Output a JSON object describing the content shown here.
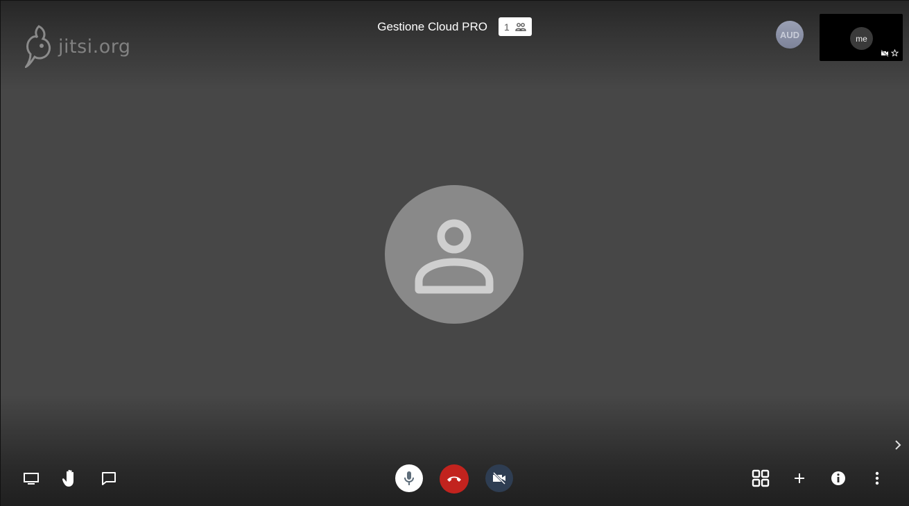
{
  "brand": {
    "logo_text": "jitsi.org"
  },
  "header": {
    "conference_name": "Gestione Cloud PRO",
    "participant_count": "1"
  },
  "remote_participant": {
    "initials": "AUD"
  },
  "local_tile": {
    "label": "me"
  },
  "colors": {
    "stage_bg": "#474747",
    "hangup": "#c2231e",
    "video_off": "#2e3d52",
    "mic_button": "#ffffff",
    "avatar_bg": "#898989"
  },
  "toolbar": {
    "left": [
      "screen-share-icon",
      "raise-hand-icon",
      "chat-icon"
    ],
    "center": [
      "microphone-icon",
      "hangup-icon",
      "camera-off-icon"
    ],
    "right": [
      "tile-view-icon",
      "invite-plus-icon",
      "info-icon",
      "more-options-icon"
    ]
  }
}
